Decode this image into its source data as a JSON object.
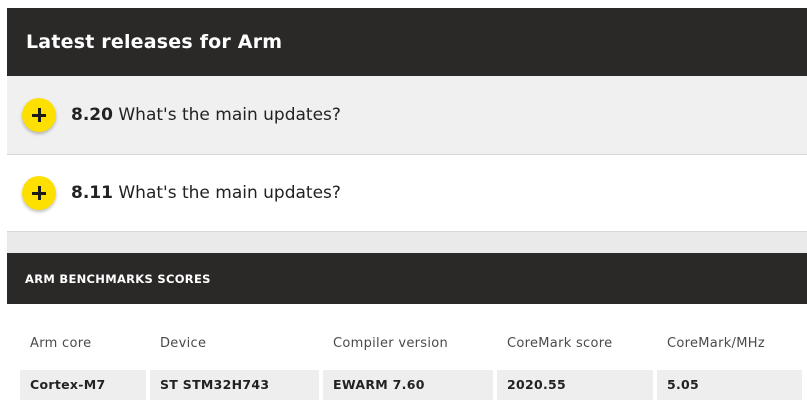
{
  "header": {
    "title": "Latest releases for Arm"
  },
  "releases": [
    {
      "version": "8.20",
      "label": "What's the main updates?",
      "icon": "plus-icon"
    },
    {
      "version": "8.11",
      "label": "What's the main updates?",
      "icon": "plus-icon"
    }
  ],
  "benchmarks": {
    "title": "ARM BENCHMARKS SCORES",
    "columns": [
      "Arm core",
      "Device",
      "Compiler version",
      "CoreMark score",
      "CoreMark/MHz"
    ],
    "rows": [
      [
        "Cortex-M7",
        "ST STM32H743",
        "EWARM 7.60",
        "2020.55",
        "5.05"
      ]
    ]
  },
  "colors": {
    "header_bg": "#2b2828",
    "accent_yellow": "#fde000",
    "row_bg": "#eeeeee"
  }
}
